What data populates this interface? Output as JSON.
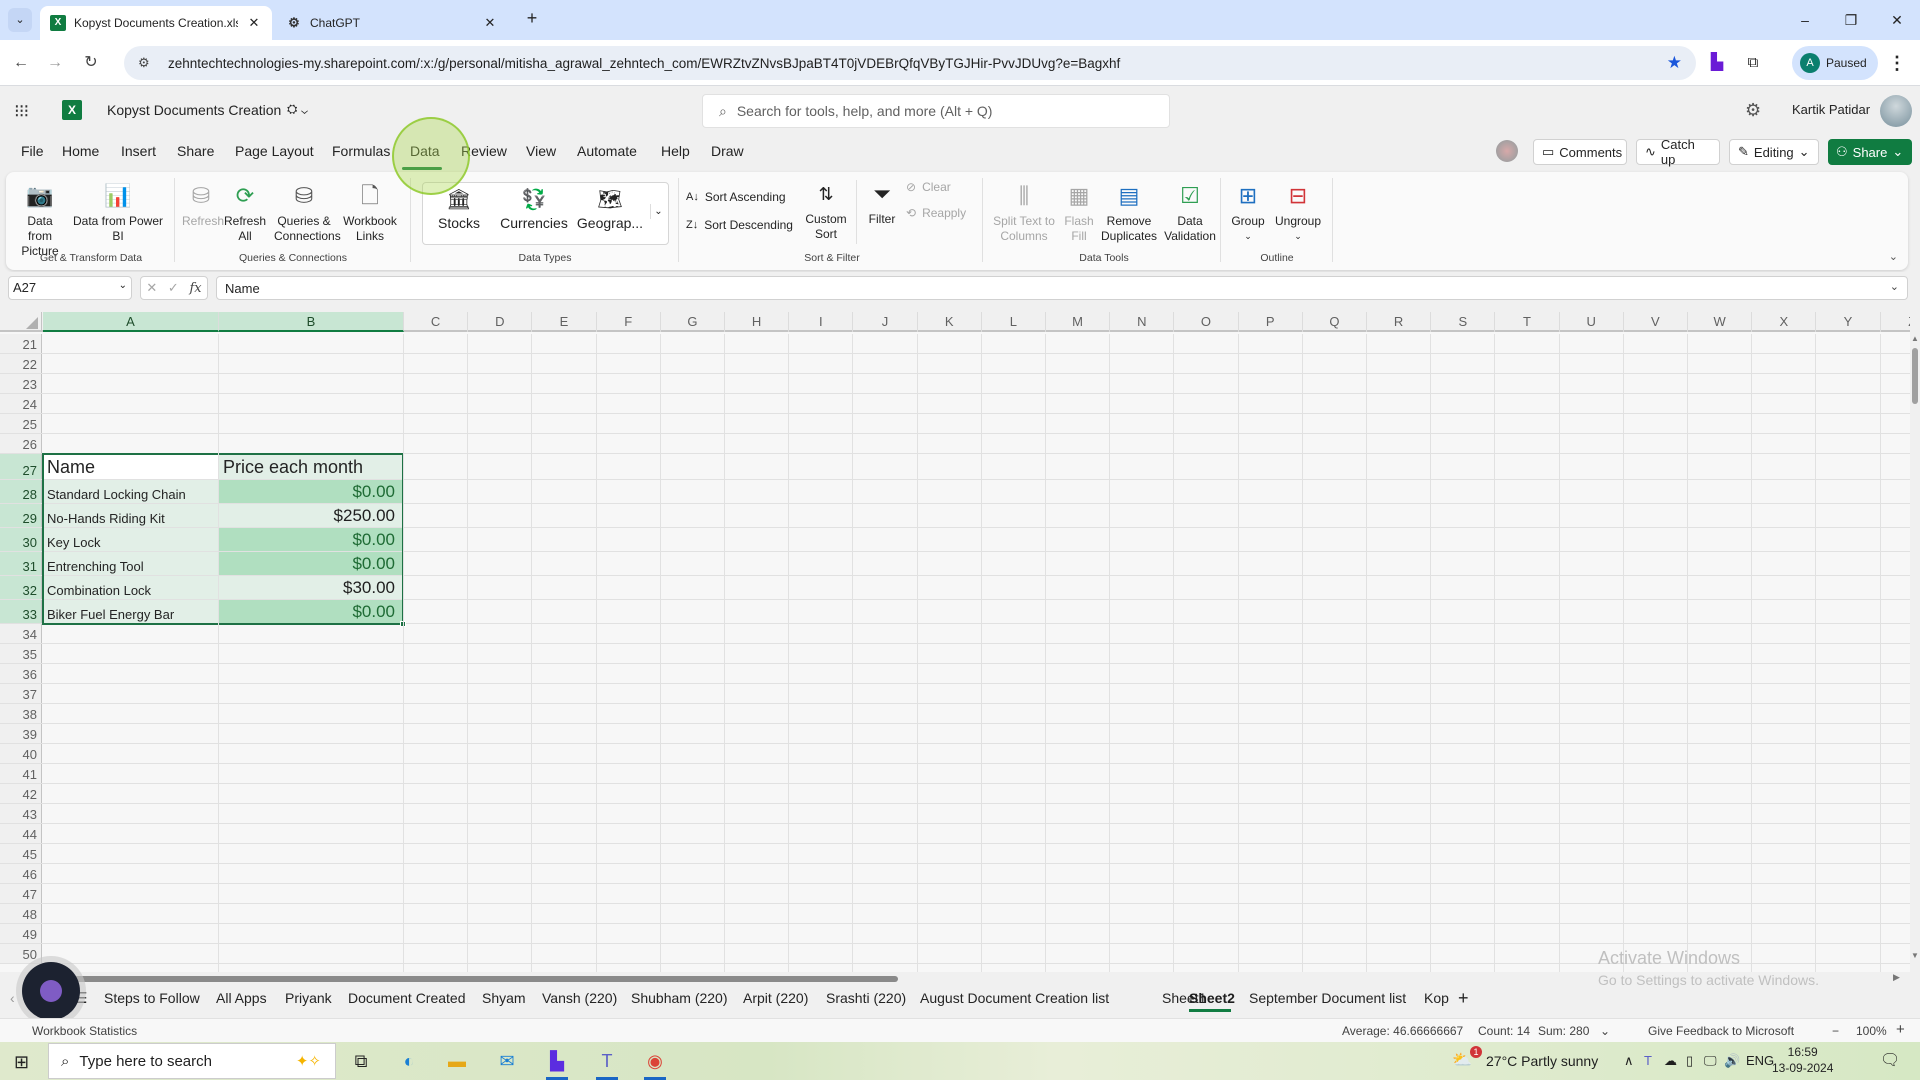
{
  "browser": {
    "tabs": [
      {
        "title": "Kopyst Documents Creation.xlsx",
        "favicon": "excel-icon",
        "active": true
      },
      {
        "title": "ChatGPT",
        "favicon": "chatgpt-icon",
        "active": false
      }
    ],
    "new_tab": "+",
    "url": "zehntechtechnologies-my.sharepoint.com/:x:/g/personal/mitisha_agrawal_zehntech_com/EWRZtvZNvsBJpaBT4T0jVDEBrQfqVByTGJHir-PvvJDUvg?e=Bagxhf",
    "profile": {
      "initial": "A",
      "status": "Paused"
    },
    "window_controls": {
      "minimize": "–",
      "restore": "❐",
      "close": "✕"
    }
  },
  "app": {
    "document_title": "Kopyst Documents Creation",
    "search_placeholder": "Search for tools, help, and more (Alt + Q)",
    "user_name": "Kartik Patidar"
  },
  "menu": {
    "items": [
      "File",
      "Home",
      "Insert",
      "Share",
      "Page Layout",
      "Formulas",
      "Data",
      "Review",
      "View",
      "Automate",
      "Help",
      "Draw"
    ],
    "active": "Data",
    "buttons": {
      "comments": "Comments",
      "catch_up": "Catch up",
      "editing": "Editing",
      "share": "Share"
    }
  },
  "ribbon": {
    "groups": [
      {
        "label": "Get & Transform Data",
        "items": [
          {
            "label": "Data from Picture"
          },
          {
            "label": "Data from Power BI"
          }
        ]
      },
      {
        "label": "Queries & Connections",
        "items": [
          {
            "label": "Refresh",
            "disabled": true
          },
          {
            "label": "Refresh All"
          },
          {
            "label": "Queries & Connections"
          },
          {
            "label": "Workbook Links"
          }
        ]
      },
      {
        "label": "Data Types",
        "items": [
          {
            "label": "Stocks"
          },
          {
            "label": "Currencies"
          },
          {
            "label": "Geograp..."
          }
        ]
      },
      {
        "label": "Sort & Filter",
        "items": [
          {
            "label": "Sort Ascending"
          },
          {
            "label": "Sort Descending"
          },
          {
            "label": "Custom Sort"
          },
          {
            "label": "Filter"
          },
          {
            "label": "Clear",
            "disabled": true
          },
          {
            "label": "Reapply",
            "disabled": true
          }
        ]
      },
      {
        "label": "Data Tools",
        "items": [
          {
            "label": "Split Text to Columns",
            "disabled": true
          },
          {
            "label": "Flash Fill",
            "disabled": true
          },
          {
            "label": "Remove Duplicates"
          },
          {
            "label": "Data Validation"
          }
        ]
      },
      {
        "label": "Outline",
        "items": [
          {
            "label": "Group"
          },
          {
            "label": "Ungroup"
          }
        ]
      }
    ]
  },
  "formula_bar": {
    "name_box": "A27",
    "content": "Name"
  },
  "grid": {
    "columns": [
      "A",
      "B",
      "C",
      "D",
      "E",
      "F",
      "G",
      "H",
      "I",
      "J",
      "K",
      "L",
      "M",
      "N",
      "O",
      "P",
      "Q",
      "R",
      "S",
      "T",
      "U",
      "V",
      "W",
      "X",
      "Y",
      "Z"
    ],
    "selected_columns": [
      "A",
      "B"
    ],
    "first_row": 21,
    "last_row": 50,
    "table": {
      "header_row": 27,
      "headers": [
        "Name",
        "Price each month"
      ],
      "rows": [
        {
          "row": 28,
          "name": "Standard Locking Chain",
          "price": "$0.00"
        },
        {
          "row": 29,
          "name": "No-Hands Riding Kit",
          "price": "$250.00"
        },
        {
          "row": 30,
          "name": "Key Lock",
          "price": "$0.00"
        },
        {
          "row": 31,
          "name": "Entrenching Tool",
          "price": "$0.00"
        },
        {
          "row": 32,
          "name": "Combination Lock",
          "price": "$30.00"
        },
        {
          "row": 33,
          "name": "Biker Fuel Energy Bar",
          "price": "$0.00"
        }
      ]
    }
  },
  "sheets": {
    "tabs": [
      "Steps to Follow",
      "All Apps",
      "Priyank",
      "Document Created",
      "Shyam",
      "Vansh (220)",
      "Shubham (220)",
      "Arpit (220)",
      "Srashti (220)",
      "August Document Creation list",
      "Sheet1",
      "Sheet2",
      "September Document list",
      "Kop"
    ],
    "active": "Sheet2"
  },
  "watermark": {
    "title": "Activate Windows",
    "subtitle": "Go to Settings to activate Windows."
  },
  "status_bar": {
    "left": "Workbook Statistics",
    "average": "Average: 46.66666667",
    "count": "Count: 14",
    "sum": "Sum: 280",
    "feedback": "Give Feedback to Microsoft",
    "zoom": "100%"
  },
  "taskbar": {
    "search_placeholder": "Type here to search",
    "weather": "27°C  Partly sunny",
    "language": "ENG",
    "time": "16:59",
    "date": "13-09-2024",
    "weather_badge": "1"
  }
}
